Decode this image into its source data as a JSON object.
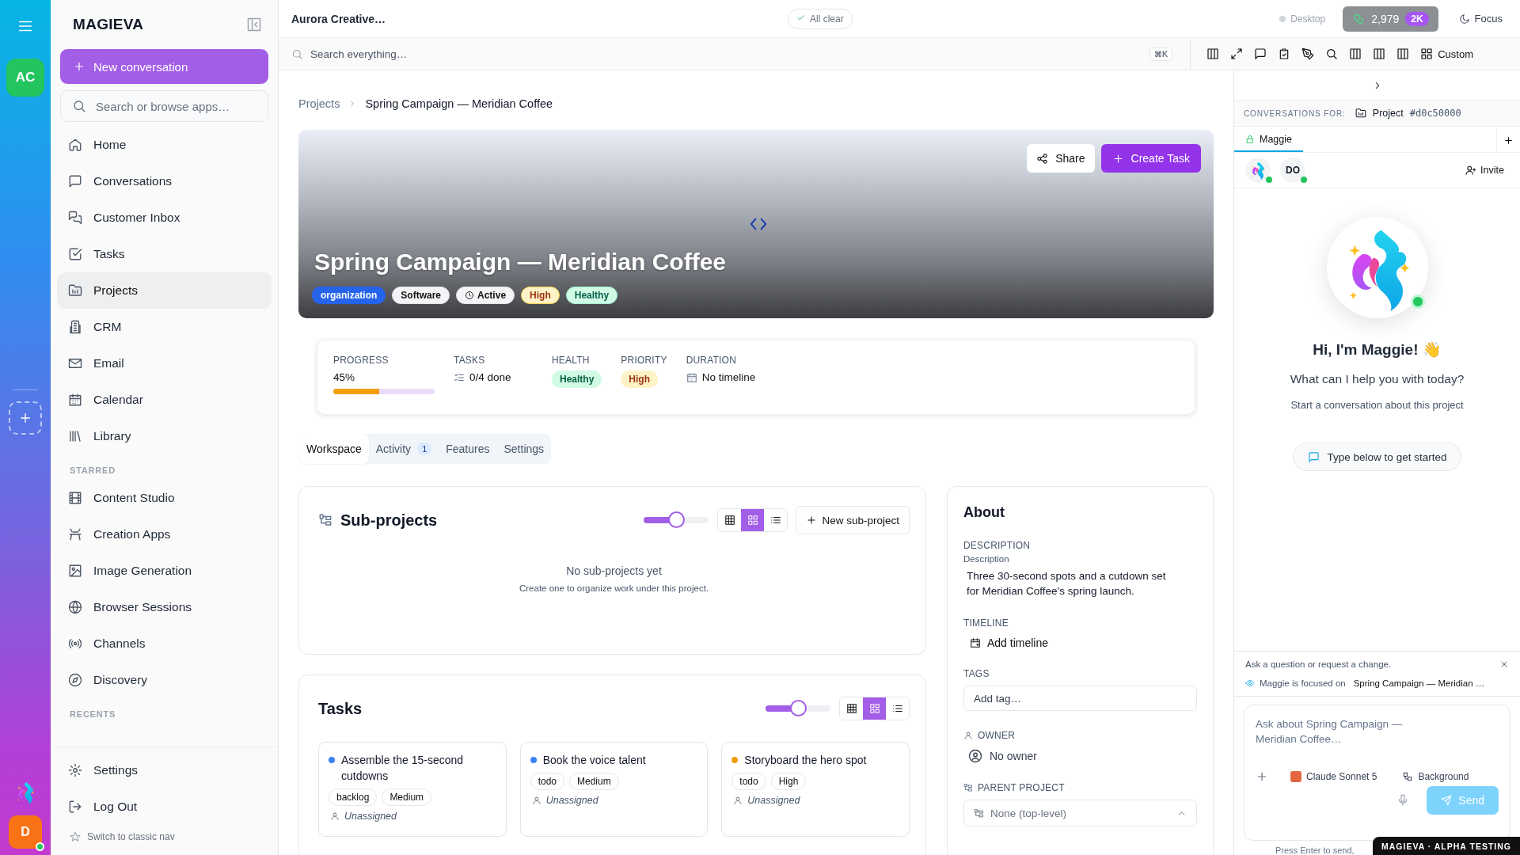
{
  "rail": {
    "workspace": "AC",
    "user": "D",
    "user_online": true
  },
  "sidebar": {
    "brand": "MAGIEVA",
    "new_button": "New conversation",
    "search": {
      "placeholder": "Search or browse apps…"
    },
    "nav": [
      {
        "label": "Home",
        "selected": false
      },
      {
        "label": "Conversations",
        "selected": false
      },
      {
        "label": "Customer Inbox",
        "selected": false
      },
      {
        "label": "Tasks",
        "selected": false
      },
      {
        "label": "Projects",
        "selected": true
      },
      {
        "label": "CRM",
        "selected": false
      },
      {
        "label": "Email",
        "selected": false
      },
      {
        "label": "Calendar",
        "selected": false
      },
      {
        "label": "Library",
        "selected": false
      }
    ],
    "starred": {
      "title": "STARRED",
      "items": [
        {
          "label": "Content Studio"
        },
        {
          "label": "Creation Apps"
        },
        {
          "label": "Image Generation"
        },
        {
          "label": "Browser Sessions"
        },
        {
          "label": "Channels"
        },
        {
          "label": "Discovery"
        }
      ]
    },
    "recents": {
      "title": "RECENTS"
    },
    "footer": [
      {
        "label": "Settings"
      },
      {
        "label": "Log Out"
      }
    ],
    "classic_link": "Switch to classic nav"
  },
  "topbar": {
    "title": "Aurora Creative…",
    "status": "All clear",
    "device": "Desktop",
    "credits": "2,979",
    "credits_badge": "2K",
    "focus": "Focus"
  },
  "searchbar": {
    "placeholder": "Search everything…",
    "shortcut": "⌘K",
    "custom": "Custom"
  },
  "breadcrumb": [
    "Projects",
    "Spring Campaign — Meridian Coffee"
  ],
  "hero": {
    "title": "Spring Campaign — Meridian Coffee",
    "share": "Share",
    "create": "Create Task",
    "tags": [
      {
        "label": "organization",
        "kind": "scope"
      },
      {
        "label": "Software",
        "kind": "category"
      },
      {
        "label": "Active",
        "kind": "status"
      },
      {
        "label": "High",
        "kind": "priority"
      },
      {
        "label": "Healthy",
        "kind": "health"
      }
    ]
  },
  "stats": [
    {
      "kind": "progress",
      "label": "PROGRESS",
      "value": "45%",
      "level": 0.45
    },
    {
      "kind": "tasks",
      "label": "TASKS",
      "value": "0/4 done"
    },
    {
      "kind": "health",
      "label": "HEALTH",
      "value": "Healthy"
    },
    {
      "kind": "priority",
      "label": "PRIORITY",
      "value": "High"
    },
    {
      "kind": "duration",
      "label": "DURATION",
      "value": "No timeline"
    }
  ],
  "tabs": [
    {
      "label": "Workspace",
      "selected": true
    },
    {
      "label": "Activity",
      "count": "1",
      "selected": false
    },
    {
      "label": "Features",
      "selected": false
    },
    {
      "label": "Settings",
      "selected": false
    }
  ],
  "subprojects": {
    "title": "Sub-projects",
    "slider": {
      "level": 0.5
    },
    "views": [
      {
        "selected": false
      },
      {
        "selected": true
      },
      {
        "selected": false
      }
    ],
    "new_button": "New sub-project",
    "empty_title": "No sub-projects yet",
    "empty_text": "Create one to organize work under this project."
  },
  "tasks": {
    "title": "Tasks",
    "slider": {
      "level": 0.5
    },
    "views": [
      {
        "selected": false
      },
      {
        "selected": true
      },
      {
        "selected": false
      }
    ],
    "items": [
      {
        "title": "Assemble the 15-second cutdowns",
        "color": "#3b82f6",
        "status": "backlog",
        "priority": "Medium",
        "assignee": "Unassigned"
      },
      {
        "title": "Book the voice talent",
        "color": "#3b82f6",
        "status": "todo",
        "priority": "Medium",
        "assignee": "Unassigned"
      },
      {
        "title": "Storyboard the hero spot",
        "color": "#f59e0b",
        "status": "todo",
        "priority": "High",
        "assignee": "Unassigned"
      }
    ]
  },
  "about": {
    "title": "About",
    "description_label": "DESCRIPTION",
    "description_sublabel": "Description",
    "description": "Three 30-second spots and a cutdown set for Meridian Coffee's spring launch.",
    "timeline_label": "TIMELINE",
    "timeline_action": "Add timeline",
    "tags_label": "TAGS",
    "tags_input": {
      "placeholder": "Add tag…"
    },
    "owner_label": "OWNER",
    "owner": "No owner",
    "parent_label": "PARENT PROJECT",
    "parent": "None (top-level)"
  },
  "assistant": {
    "context_label": "CONVERSATIONS FOR:",
    "context_type": "Project",
    "context_id": "#d0c50000",
    "tabs": [
      {
        "label": "Maggie",
        "selected": true
      }
    ],
    "participants": [
      {
        "kind": "bot",
        "online": true
      },
      {
        "kind": "user",
        "initials": "DO",
        "online": true
      }
    ],
    "invite": "Invite",
    "online": true,
    "greeting": "Hi, I'm Maggie! 👋",
    "question": "What can I help you with today?",
    "hint": "Start a conversation about this project",
    "prompt_chip": "Type below to get started",
    "banner": "Ask a question or request a change.",
    "focus_label": "Maggie is focused on",
    "focus_target": "Spring Campaign — Meridian …",
    "input": {
      "placeholder": "Ask about Spring Campaign — Meridian Coffee…"
    },
    "model": "Claude Sonnet 5",
    "mode": "Background",
    "send": "Send",
    "send_disabled": true,
    "footnote": "Press Enter to send,",
    "build_badge": "MAGIEVA · ALPHA TESTING"
  }
}
